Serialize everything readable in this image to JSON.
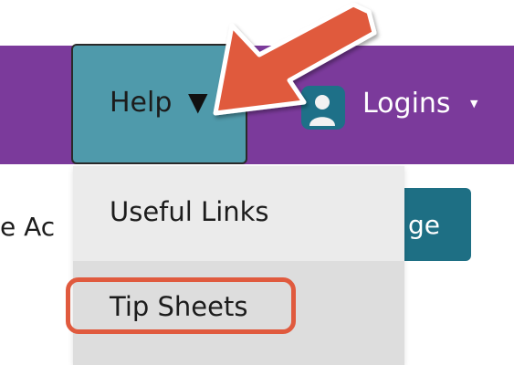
{
  "navbar": {
    "help_label": "Help",
    "help_caret": "▼",
    "logins_label": "Logins",
    "logins_caret": "▼"
  },
  "page": {
    "behind_text": "e Ac",
    "button_fragment": "ge"
  },
  "dropdown": {
    "items": [
      {
        "label": "Useful Links"
      },
      {
        "label": "Tip Sheets"
      }
    ]
  },
  "colors": {
    "navbar_bg": "#7b3a9b",
    "help_button_bg": "#4f9aab",
    "arrow": "#e05a3e",
    "highlight": "#e05a3e",
    "teal_button": "#1e6f84"
  },
  "icons": {
    "logins_icon": "user-icon",
    "arrow": "callout-arrow-icon"
  }
}
